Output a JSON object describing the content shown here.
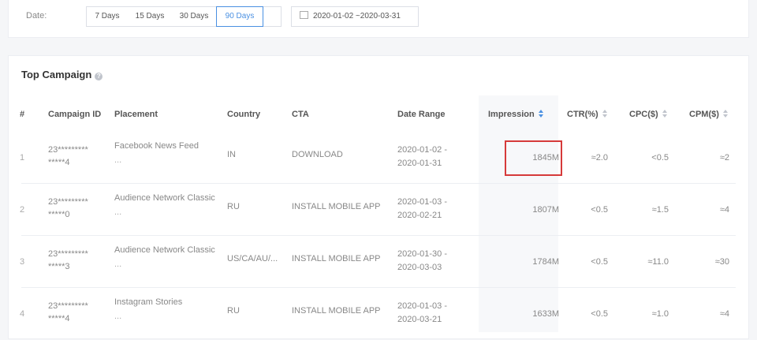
{
  "date_filter": {
    "label": "Date:",
    "options": [
      "7 Days",
      "15 Days",
      "30 Days",
      "90 Days"
    ],
    "selected": "90 Days",
    "range": "2020-01-02 ~2020-03-31"
  },
  "campaign": {
    "title": "Top Campaign",
    "columns": {
      "index": "#",
      "campaign_id": "Campaign ID",
      "placement": "Placement",
      "country": "Country",
      "cta": "CTA",
      "date_range": "Date Range",
      "impression": "Impression",
      "ctr": "CTR(%)",
      "cpc": "CPC($)",
      "cpm": "CPM($)"
    },
    "rows": [
      {
        "index": "1",
        "id_line1": "23*********",
        "id_line2": "*****4",
        "placement": "Facebook News Feed",
        "placement_more": "...",
        "country": "IN",
        "cta": "DOWNLOAD",
        "date_start": "2020-01-02 -",
        "date_end": "2020-01-31",
        "impression": "1845M",
        "ctr": "≈2.0",
        "cpc": "<0.5",
        "cpm": "≈2"
      },
      {
        "index": "2",
        "id_line1": "23*********",
        "id_line2": "*****0",
        "placement": "Audience Network Classic",
        "placement_more": "...",
        "country": "RU",
        "cta": "INSTALL MOBILE APP",
        "date_start": "2020-01-03 -",
        "date_end": "2020-02-21",
        "impression": "1807M",
        "ctr": "<0.5",
        "cpc": "≈1.5",
        "cpm": "≈4"
      },
      {
        "index": "3",
        "id_line1": "23*********",
        "id_line2": "*****3",
        "placement": "Audience Network Classic",
        "placement_more": "...",
        "country": "US/CA/AU/...",
        "cta": "INSTALL MOBILE APP",
        "date_start": "2020-01-30 -",
        "date_end": "2020-03-03",
        "impression": "1784M",
        "ctr": "<0.5",
        "cpc": "≈11.0",
        "cpm": "≈30"
      },
      {
        "index": "4",
        "id_line1": "23*********",
        "id_line2": "*****4",
        "placement": "Instagram Stories",
        "placement_more": "...",
        "country": "RU",
        "cta": "INSTALL MOBILE APP",
        "date_start": "2020-01-03 -",
        "date_end": "2020-03-21",
        "impression": "1633M",
        "ctr": "<0.5",
        "cpc": "≈1.0",
        "cpm": "≈4"
      }
    ]
  },
  "colors": {
    "accent": "#4a90e2",
    "highlight": "#d63a3a"
  }
}
